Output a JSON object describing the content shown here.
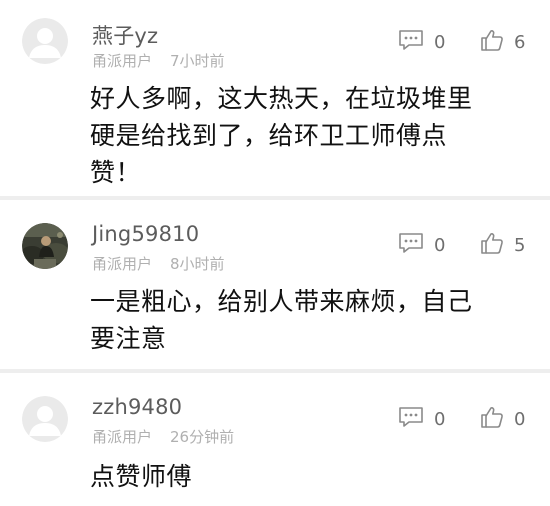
{
  "comments": [
    {
      "username": "燕子yz",
      "source": "甬派用户",
      "time": "7小时前",
      "reply_count": "0",
      "like_count": "6",
      "body_lines": [
        "好人多啊，这大热天，在垃圾堆里",
        "硬是给找到了，给环卫工师傅点",
        "赞！"
      ]
    },
    {
      "username": "Jing59810",
      "source": "甬派用户",
      "time": "8小时前",
      "reply_count": "0",
      "like_count": "5",
      "body_lines": [
        "一是粗心，给别人带来麻烦，自己",
        "要注意"
      ]
    },
    {
      "username": "zzh9480",
      "source": "甬派用户",
      "time": "26分钟前",
      "reply_count": "0",
      "like_count": "0",
      "body_lines": [
        "点赞师傅"
      ]
    }
  ],
  "icons": {
    "reply": "comment-bubble-icon",
    "like": "thumbs-up-icon",
    "default_avatar": "default-avatar-icon",
    "photo_avatar": "user-photo-avatar"
  },
  "colors": {
    "icon": "#8a8a8a",
    "meta_text": "#b0b0b0",
    "username_text": "#5c5c5c",
    "separator": "#eeeeee"
  }
}
